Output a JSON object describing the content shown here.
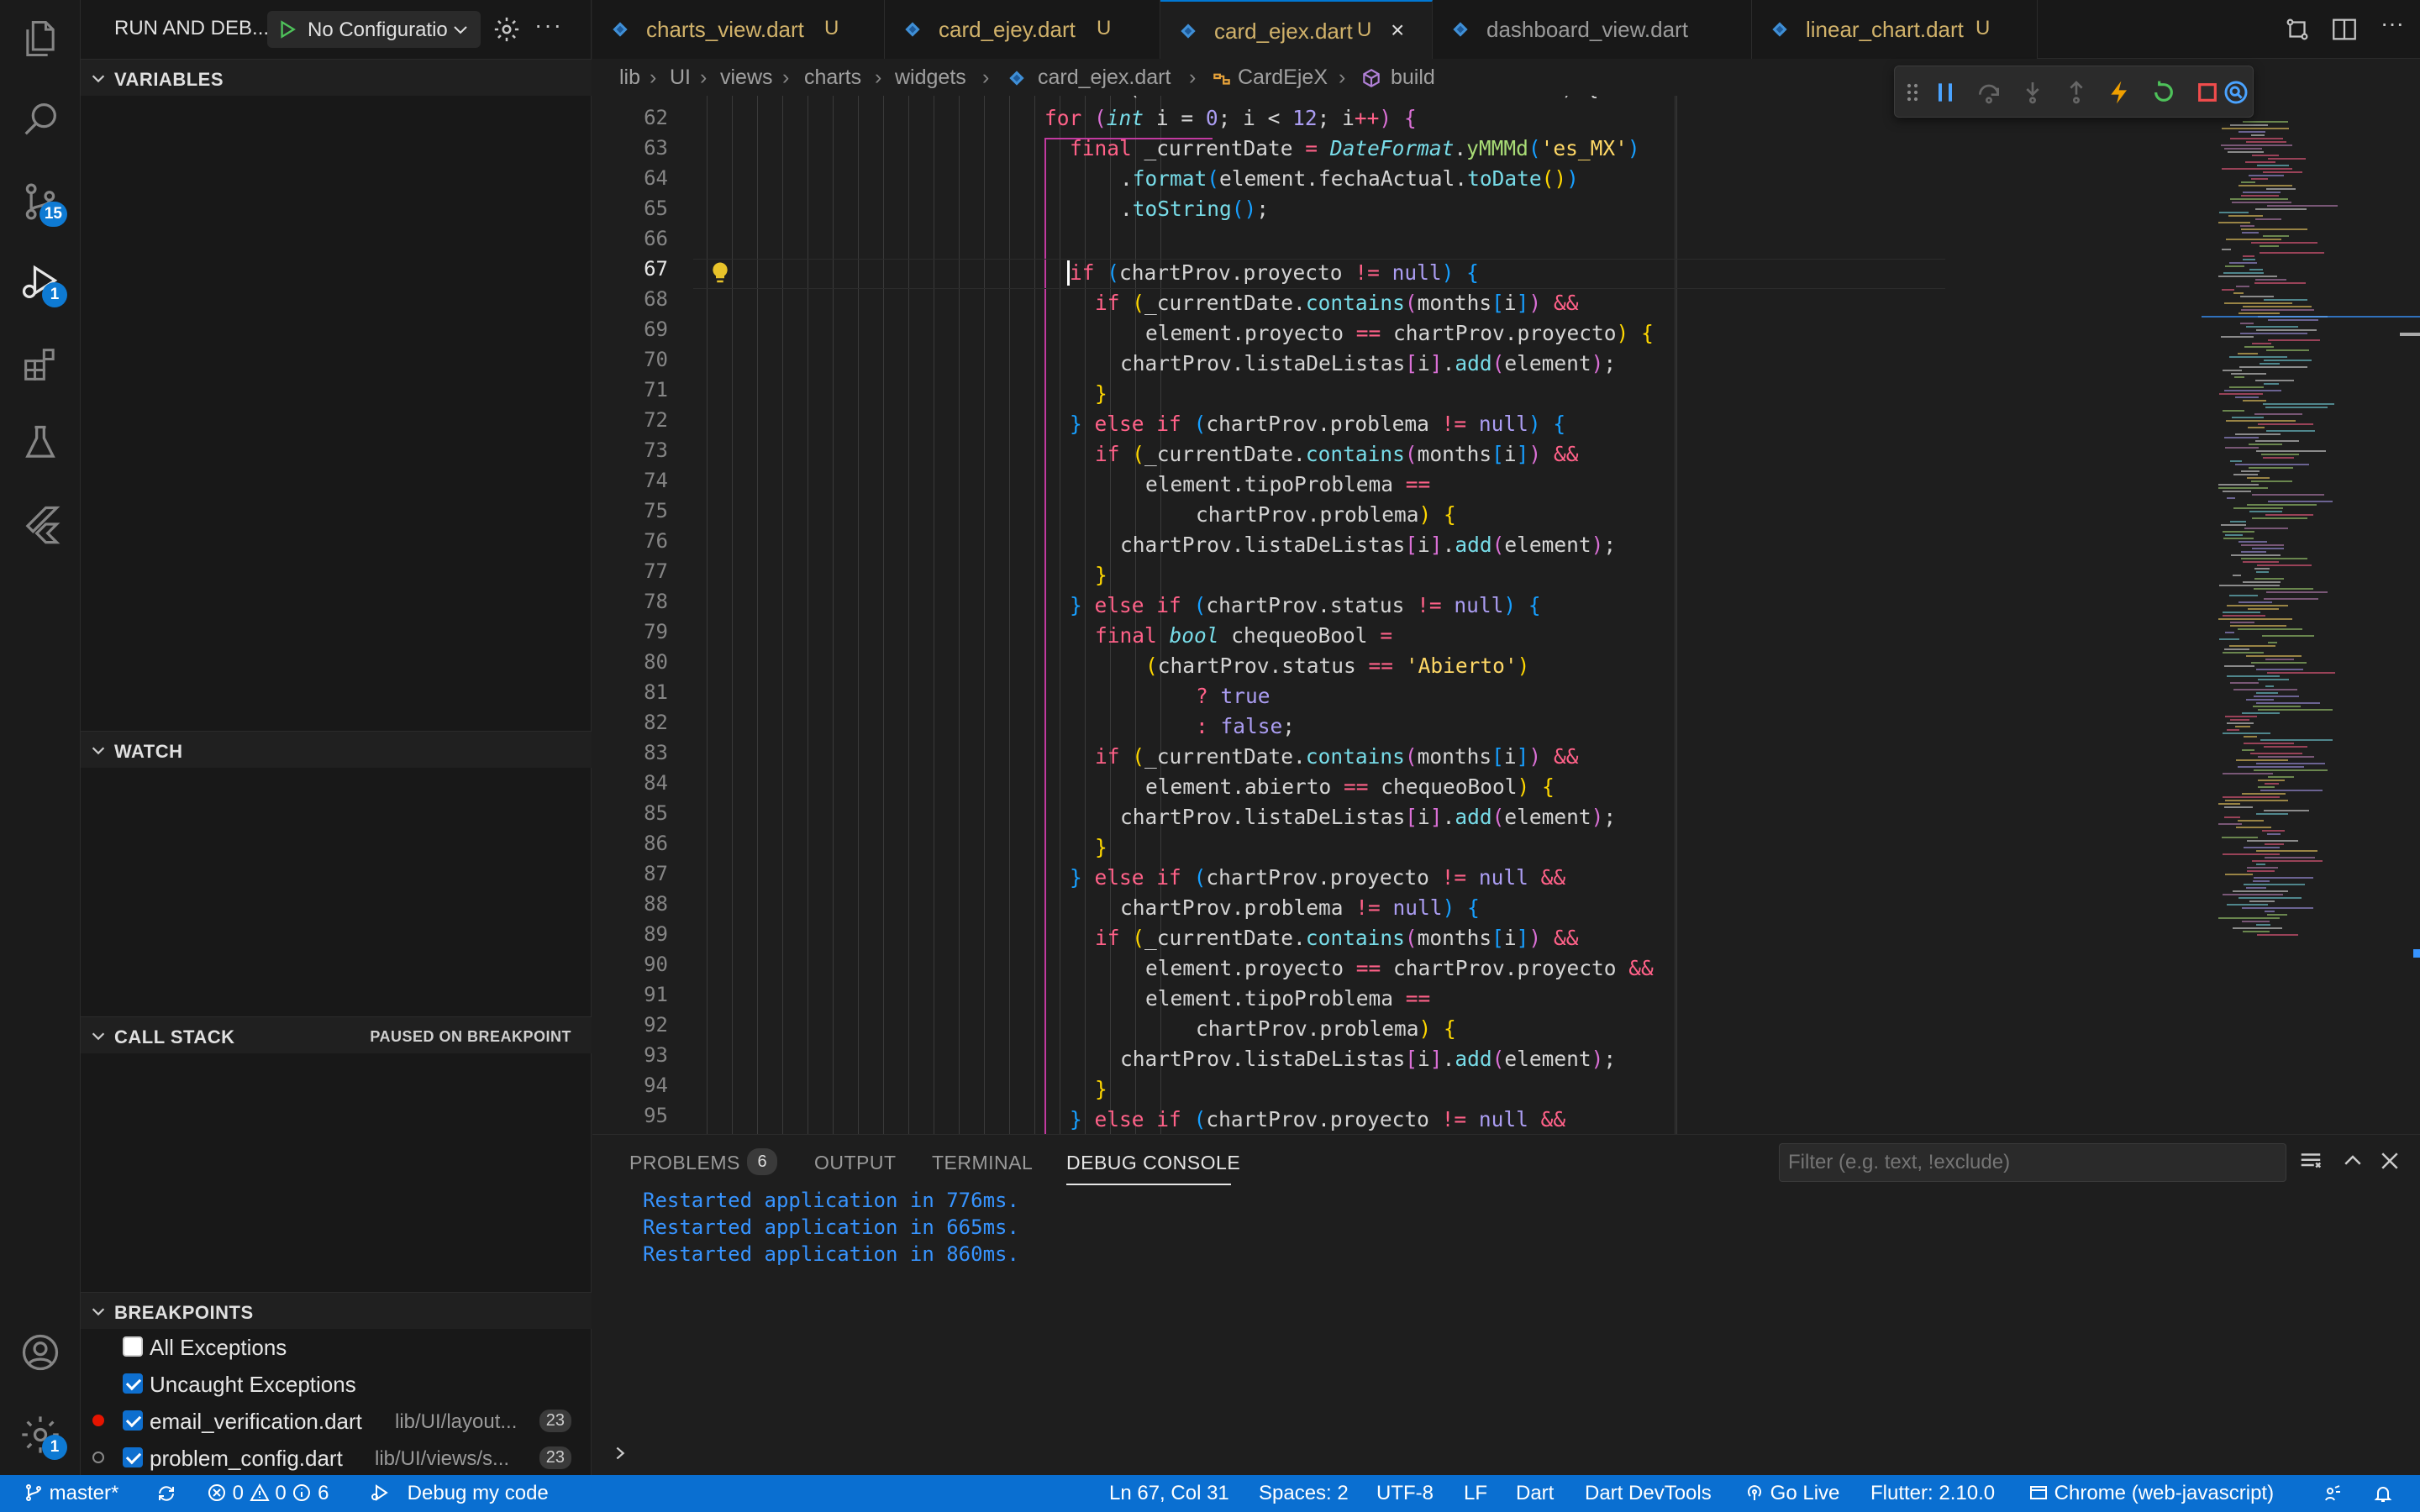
{
  "activity": {
    "scm_badge": "15",
    "debug_badge": "1",
    "settings_badge": "1"
  },
  "sidebar": {
    "title": "RUN AND DEB...",
    "config_label": "No Configuratio",
    "sections": {
      "variables": "VARIABLES",
      "watch": "WATCH",
      "call_stack": "CALL STACK",
      "call_stack_status": "PAUSED ON BREAKPOINT",
      "breakpoints": "BREAKPOINTS"
    },
    "breakpoints": [
      {
        "label": "All Exceptions",
        "checked": false,
        "path": "",
        "count": ""
      },
      {
        "label": "Uncaught Exceptions",
        "checked": true,
        "path": "",
        "count": ""
      },
      {
        "label": "email_verification.dart",
        "checked": true,
        "path": "lib/UI/layout...",
        "count": "23",
        "dot": "#e51400"
      },
      {
        "label": "problem_config.dart",
        "checked": true,
        "path": "lib/UI/views/s...",
        "count": "23",
        "dot": "hollow"
      }
    ]
  },
  "tabs": [
    {
      "name": "charts_view.dart",
      "status": "U",
      "active": false
    },
    {
      "name": "card_ejey.dart",
      "status": "U",
      "active": false
    },
    {
      "name": "card_ejex.dart",
      "status": "U",
      "active": true
    },
    {
      "name": "dashboard_view.dart",
      "status": "",
      "active": false
    },
    {
      "name": "linear_chart.dart",
      "status": "U",
      "active": false
    }
  ],
  "breadcrumb": {
    "parts": [
      "lib",
      "UI",
      "views",
      "charts",
      "widgets",
      "card_ejex.dart",
      "CardEjeX",
      "build"
    ]
  },
  "editor": {
    "line_numbers": [
      "62",
      "63",
      "64",
      "65",
      "66",
      "67",
      "68",
      "69",
      "70",
      "71",
      "72",
      "73",
      "74",
      "75",
      "76",
      "77",
      "78",
      "79",
      "80",
      "81",
      "82",
      "83",
      "84",
      "85",
      "86",
      "87",
      "88",
      "89",
      "90",
      "91",
      "92",
      "93",
      "94",
      "95"
    ],
    "current_line": "67"
  },
  "panel": {
    "tabs": [
      "PROBLEMS",
      "OUTPUT",
      "TERMINAL",
      "DEBUG CONSOLE"
    ],
    "problems_count": "6",
    "filter_placeholder": "Filter (e.g. text, !exclude)",
    "console_lines": [
      "Restarted application in 776ms.",
      "Restarted application in 665ms.",
      "Restarted application in 860ms."
    ]
  },
  "statusbar": {
    "branch": "master*",
    "errors": "0",
    "warnings": "0",
    "infos": "6",
    "debug": "Debug my code",
    "position": "Ln 67, Col 31",
    "spaces": "Spaces: 2",
    "encoding": "UTF-8",
    "eol": "LF",
    "language": "Dart",
    "devtools": "Dart DevTools",
    "golive": "Go Live",
    "flutter": "Flutter: 2.10.0",
    "device": "Chrome (web-javascript)"
  }
}
